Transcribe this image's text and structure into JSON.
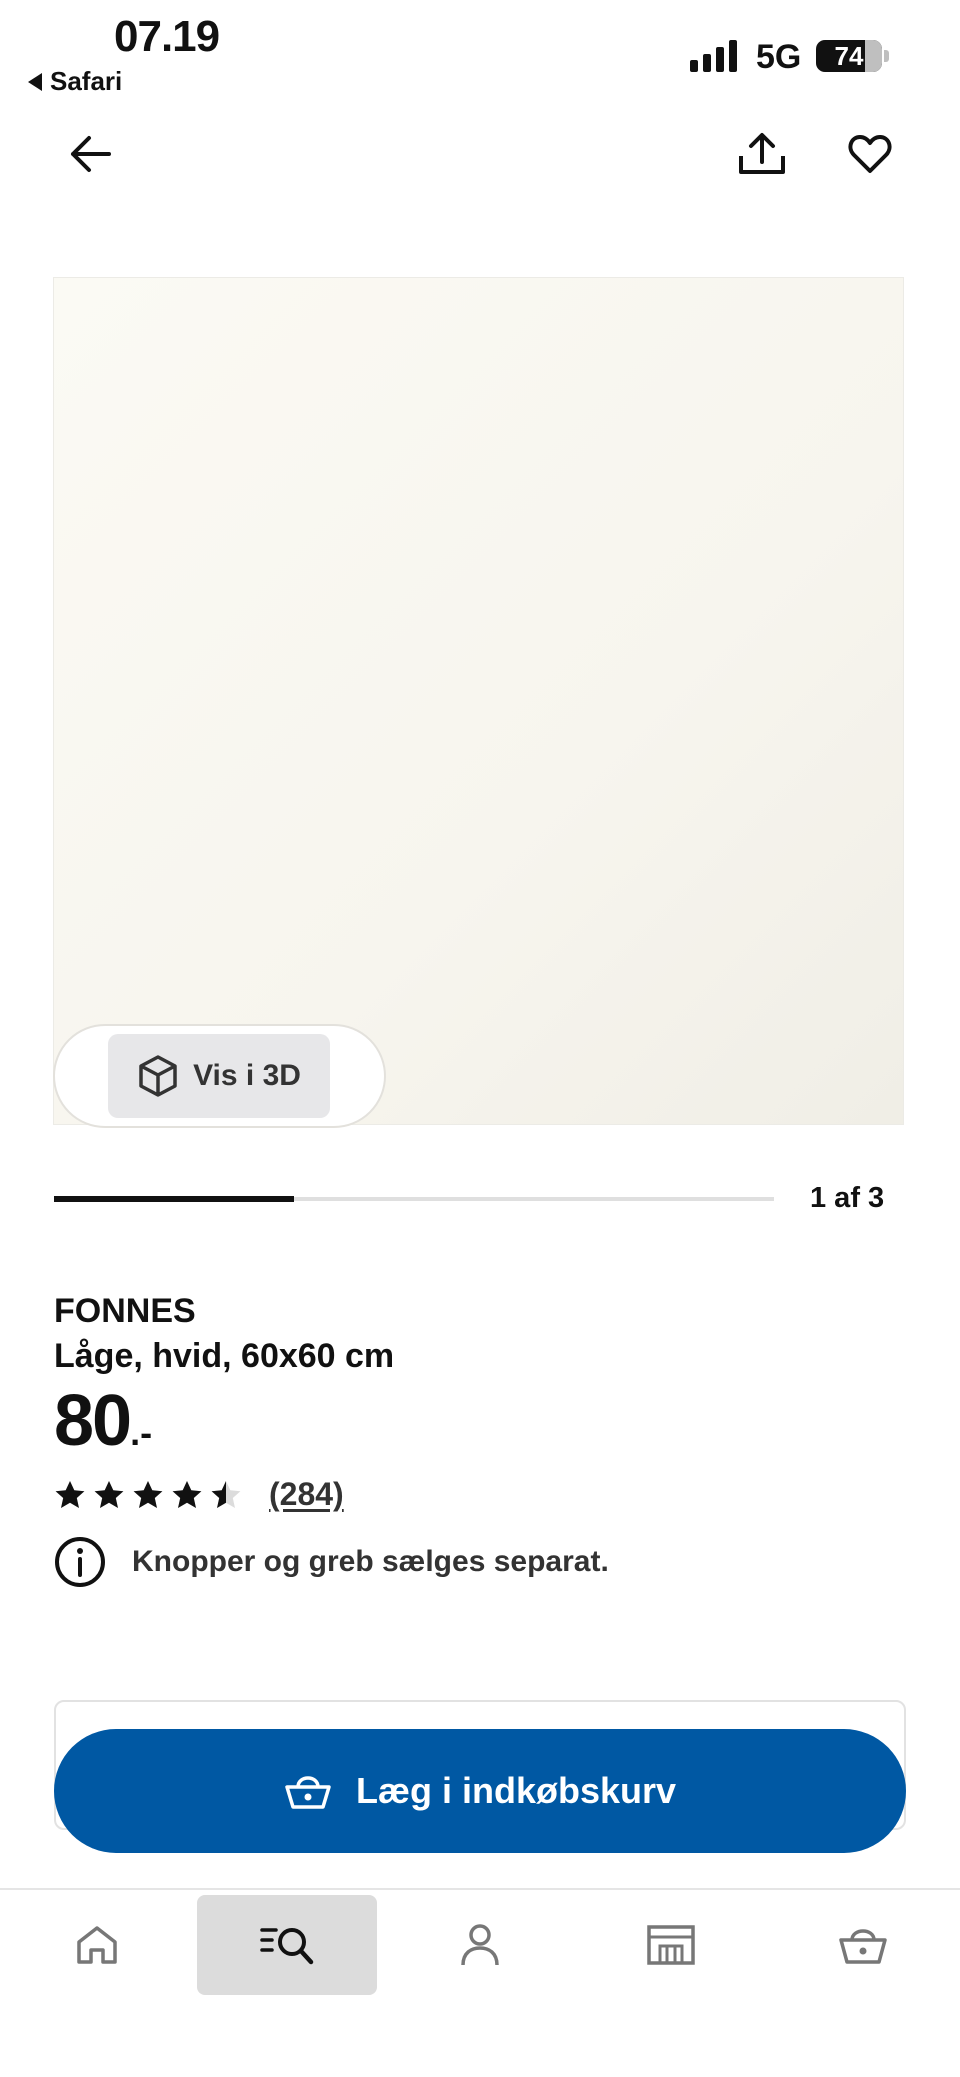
{
  "status_bar": {
    "time": "07.19",
    "back_app": "Safari",
    "network": "5G",
    "battery": "74",
    "battery_level": 0.74
  },
  "header": {
    "back_icon": "arrow-left-icon",
    "share_icon": "share-icon",
    "favorite_icon": "heart-icon"
  },
  "gallery": {
    "view_3d_label": "Vis i 3D",
    "view_3d_icon": "cube-icon",
    "progress": 0.333,
    "counter": "1 af 3"
  },
  "product": {
    "brand": "FONNES",
    "description": "Låge, hvid, 60x60 cm",
    "price_integer": "80",
    "price_decimal": ".-",
    "rating": 4.5,
    "rating_max": 5,
    "review_count": "(284)",
    "notice_icon": "info-icon",
    "notice": "Knopper og greb sælges separat."
  },
  "cart": {
    "label": "Læg i indkøbskurv",
    "icon": "basket-icon"
  },
  "bottom_nav": {
    "items": [
      {
        "name": "home",
        "icon": "home-icon"
      },
      {
        "name": "search",
        "icon": "search-icon",
        "active": true
      },
      {
        "name": "account",
        "icon": "user-icon"
      },
      {
        "name": "stores",
        "icon": "store-icon"
      },
      {
        "name": "cart",
        "icon": "basket-icon"
      }
    ]
  },
  "colors": {
    "accent": "#0058a3",
    "text": "#111111",
    "nav_active_bg": "#dcdcdc",
    "image_bg": "#f7f5ee"
  }
}
